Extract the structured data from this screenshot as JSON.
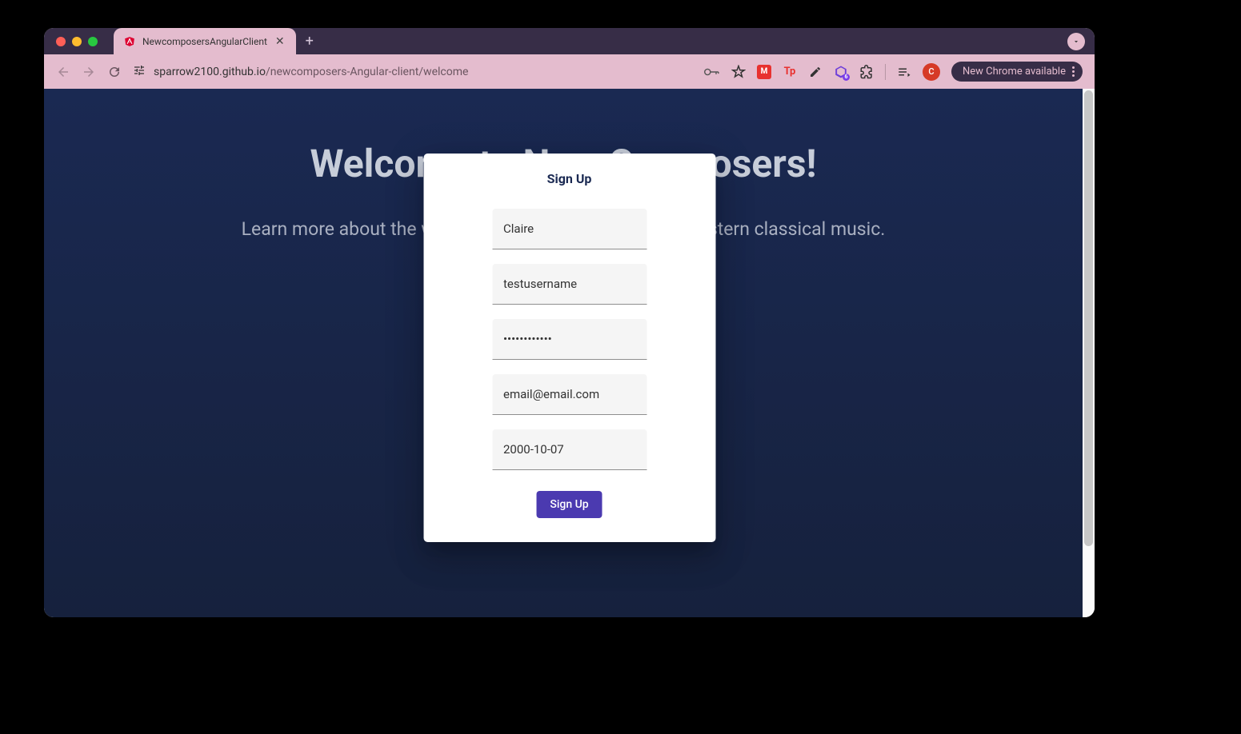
{
  "browser": {
    "tab_title": "NewcomposersAngularClient",
    "url_host": "sparrow2100.github.io",
    "url_path": "/newcomposers-Angular-client/welcome",
    "chrome_update": "New Chrome available",
    "avatar_letter": "C"
  },
  "page": {
    "hero_title": "Welcome to New Composers!",
    "hero_subtitle": "Learn more about the work of emerging composers in western classical music."
  },
  "modal": {
    "title": "Sign Up",
    "fields": {
      "name": "Claire",
      "username": "testusername",
      "password": "••••••••••••",
      "email": "email@email.com",
      "birthdate": "2000-10-07"
    },
    "submit_label": "Sign Up"
  }
}
